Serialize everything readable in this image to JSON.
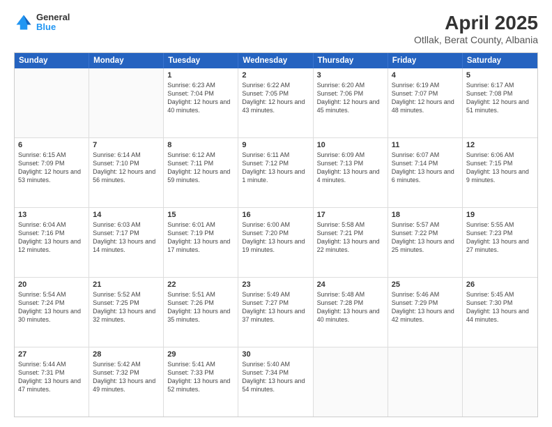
{
  "logo": {
    "general": "General",
    "blue": "Blue"
  },
  "title": "April 2025",
  "subtitle": "Otllak, Berat County, Albania",
  "days": [
    "Sunday",
    "Monday",
    "Tuesday",
    "Wednesday",
    "Thursday",
    "Friday",
    "Saturday"
  ],
  "weeks": [
    [
      {
        "day": "",
        "info": ""
      },
      {
        "day": "",
        "info": ""
      },
      {
        "day": "1",
        "info": "Sunrise: 6:23 AM\nSunset: 7:04 PM\nDaylight: 12 hours and 40 minutes."
      },
      {
        "day": "2",
        "info": "Sunrise: 6:22 AM\nSunset: 7:05 PM\nDaylight: 12 hours and 43 minutes."
      },
      {
        "day": "3",
        "info": "Sunrise: 6:20 AM\nSunset: 7:06 PM\nDaylight: 12 hours and 45 minutes."
      },
      {
        "day": "4",
        "info": "Sunrise: 6:19 AM\nSunset: 7:07 PM\nDaylight: 12 hours and 48 minutes."
      },
      {
        "day": "5",
        "info": "Sunrise: 6:17 AM\nSunset: 7:08 PM\nDaylight: 12 hours and 51 minutes."
      }
    ],
    [
      {
        "day": "6",
        "info": "Sunrise: 6:15 AM\nSunset: 7:09 PM\nDaylight: 12 hours and 53 minutes."
      },
      {
        "day": "7",
        "info": "Sunrise: 6:14 AM\nSunset: 7:10 PM\nDaylight: 12 hours and 56 minutes."
      },
      {
        "day": "8",
        "info": "Sunrise: 6:12 AM\nSunset: 7:11 PM\nDaylight: 12 hours and 59 minutes."
      },
      {
        "day": "9",
        "info": "Sunrise: 6:11 AM\nSunset: 7:12 PM\nDaylight: 13 hours and 1 minute."
      },
      {
        "day": "10",
        "info": "Sunrise: 6:09 AM\nSunset: 7:13 PM\nDaylight: 13 hours and 4 minutes."
      },
      {
        "day": "11",
        "info": "Sunrise: 6:07 AM\nSunset: 7:14 PM\nDaylight: 13 hours and 6 minutes."
      },
      {
        "day": "12",
        "info": "Sunrise: 6:06 AM\nSunset: 7:15 PM\nDaylight: 13 hours and 9 minutes."
      }
    ],
    [
      {
        "day": "13",
        "info": "Sunrise: 6:04 AM\nSunset: 7:16 PM\nDaylight: 13 hours and 12 minutes."
      },
      {
        "day": "14",
        "info": "Sunrise: 6:03 AM\nSunset: 7:17 PM\nDaylight: 13 hours and 14 minutes."
      },
      {
        "day": "15",
        "info": "Sunrise: 6:01 AM\nSunset: 7:19 PM\nDaylight: 13 hours and 17 minutes."
      },
      {
        "day": "16",
        "info": "Sunrise: 6:00 AM\nSunset: 7:20 PM\nDaylight: 13 hours and 19 minutes."
      },
      {
        "day": "17",
        "info": "Sunrise: 5:58 AM\nSunset: 7:21 PM\nDaylight: 13 hours and 22 minutes."
      },
      {
        "day": "18",
        "info": "Sunrise: 5:57 AM\nSunset: 7:22 PM\nDaylight: 13 hours and 25 minutes."
      },
      {
        "day": "19",
        "info": "Sunrise: 5:55 AM\nSunset: 7:23 PM\nDaylight: 13 hours and 27 minutes."
      }
    ],
    [
      {
        "day": "20",
        "info": "Sunrise: 5:54 AM\nSunset: 7:24 PM\nDaylight: 13 hours and 30 minutes."
      },
      {
        "day": "21",
        "info": "Sunrise: 5:52 AM\nSunset: 7:25 PM\nDaylight: 13 hours and 32 minutes."
      },
      {
        "day": "22",
        "info": "Sunrise: 5:51 AM\nSunset: 7:26 PM\nDaylight: 13 hours and 35 minutes."
      },
      {
        "day": "23",
        "info": "Sunrise: 5:49 AM\nSunset: 7:27 PM\nDaylight: 13 hours and 37 minutes."
      },
      {
        "day": "24",
        "info": "Sunrise: 5:48 AM\nSunset: 7:28 PM\nDaylight: 13 hours and 40 minutes."
      },
      {
        "day": "25",
        "info": "Sunrise: 5:46 AM\nSunset: 7:29 PM\nDaylight: 13 hours and 42 minutes."
      },
      {
        "day": "26",
        "info": "Sunrise: 5:45 AM\nSunset: 7:30 PM\nDaylight: 13 hours and 44 minutes."
      }
    ],
    [
      {
        "day": "27",
        "info": "Sunrise: 5:44 AM\nSunset: 7:31 PM\nDaylight: 13 hours and 47 minutes."
      },
      {
        "day": "28",
        "info": "Sunrise: 5:42 AM\nSunset: 7:32 PM\nDaylight: 13 hours and 49 minutes."
      },
      {
        "day": "29",
        "info": "Sunrise: 5:41 AM\nSunset: 7:33 PM\nDaylight: 13 hours and 52 minutes."
      },
      {
        "day": "30",
        "info": "Sunrise: 5:40 AM\nSunset: 7:34 PM\nDaylight: 13 hours and 54 minutes."
      },
      {
        "day": "",
        "info": ""
      },
      {
        "day": "",
        "info": ""
      },
      {
        "day": "",
        "info": ""
      }
    ]
  ]
}
